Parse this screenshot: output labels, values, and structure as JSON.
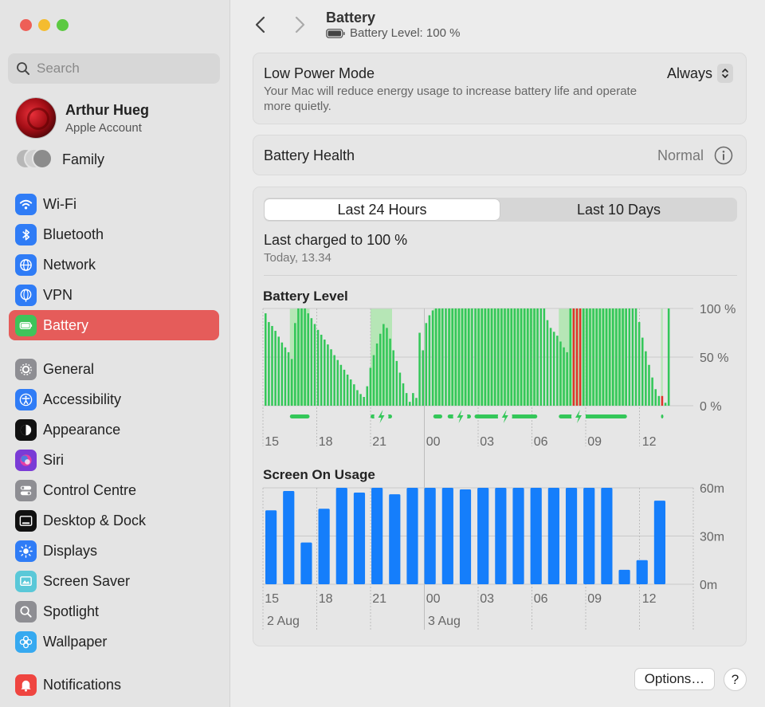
{
  "sidebar": {
    "search_placeholder": "Search",
    "account": {
      "name": "Arthur Hueg",
      "subtitle": "Apple Account"
    },
    "family_label": "Family",
    "items": [
      {
        "label": "Wi-Fi",
        "icon": "wifi-icon",
        "color": "#2f7cf6"
      },
      {
        "label": "Bluetooth",
        "icon": "bluetooth-icon",
        "color": "#2f7cf6"
      },
      {
        "label": "Network",
        "icon": "globe-icon",
        "color": "#2f7cf6"
      },
      {
        "label": "VPN",
        "icon": "vpn-globe-icon",
        "color": "#2f7cf6"
      },
      {
        "label": "Battery",
        "icon": "battery-icon",
        "color": "#3fc35a",
        "active": true
      },
      {
        "label": "General",
        "icon": "gear-icon",
        "color": "#8e8e93"
      },
      {
        "label": "Accessibility",
        "icon": "accessibility-icon",
        "color": "#2f7cf6"
      },
      {
        "label": "Appearance",
        "icon": "appearance-icon",
        "color": "#111111"
      },
      {
        "label": "Siri",
        "icon": "siri-icon",
        "color": "#7a3bd6"
      },
      {
        "label": "Control Centre",
        "icon": "control-centre-icon",
        "color": "#8e8e93"
      },
      {
        "label": "Desktop & Dock",
        "icon": "dock-icon",
        "color": "#111111"
      },
      {
        "label": "Displays",
        "icon": "sun-icon",
        "color": "#2f7cf6"
      },
      {
        "label": "Screen Saver",
        "icon": "screen-saver-icon",
        "color": "#5ac8d8"
      },
      {
        "label": "Spotlight",
        "icon": "magnifier-icon",
        "color": "#8e8e93"
      },
      {
        "label": "Wallpaper",
        "icon": "flower-icon",
        "color": "#36a9f0"
      },
      {
        "label": "Notifications",
        "icon": "bell-icon",
        "color": "#ef4540"
      }
    ]
  },
  "header": {
    "title": "Battery",
    "subtitle": "Battery Level: 100 %"
  },
  "low_power": {
    "title": "Low Power Mode",
    "description": "Your Mac will reduce energy usage to increase battery life and operate more quietly.",
    "value": "Always"
  },
  "health": {
    "label": "Battery Health",
    "value": "Normal"
  },
  "tabs": {
    "active": "Last 24 Hours",
    "inactive": "Last 10 Days"
  },
  "last_charged": {
    "title": "Last charged to 100 %",
    "time": "Today, 13.34"
  },
  "colors": {
    "battery_green": "#34c759",
    "charging_green": "#b6e6b6",
    "low_red": "#e0322b",
    "usage_blue": "#157efb",
    "active_red": "#e55c5a"
  },
  "chart_data": [
    {
      "type": "bar",
      "title": "Battery Level",
      "y_ticks": [
        "100 %",
        "50 %",
        "0 %"
      ],
      "ylim": [
        0,
        100
      ],
      "x_ticks": [
        "15",
        "18",
        "21",
        "00",
        "03",
        "06",
        "09",
        "12"
      ],
      "values": [
        95,
        86,
        82,
        77,
        71,
        65,
        60,
        55,
        48,
        85,
        100,
        100,
        100,
        95,
        90,
        84,
        78,
        73,
        68,
        63,
        58,
        52,
        47,
        42,
        37,
        32,
        27,
        22,
        16,
        12,
        9,
        20,
        39,
        52,
        64,
        74,
        84,
        80,
        69,
        57,
        46,
        34,
        23,
        13,
        4,
        13,
        8,
        75,
        57,
        85,
        93,
        98,
        100,
        100,
        100,
        100,
        100,
        100,
        100,
        100,
        100,
        100,
        100,
        100,
        100,
        100,
        100,
        100,
        100,
        100,
        100,
        100,
        100,
        100,
        100,
        100,
        100,
        100,
        100,
        100,
        100,
        100,
        100,
        100,
        100,
        100,
        88,
        80,
        76,
        72,
        66,
        60,
        55,
        100,
        100,
        100,
        100,
        100,
        100,
        100,
        100,
        100,
        100,
        100,
        100,
        100,
        100,
        100,
        100,
        100,
        100,
        100,
        100,
        100,
        86,
        70,
        56,
        42,
        29,
        17,
        10,
        10,
        3,
        100
      ],
      "low_indices": [
        94,
        95,
        96,
        121
      ],
      "charging_periods_hours": [
        [
          1.5,
          2.6
        ],
        [
          6.0,
          7.2
        ],
        [
          9.5,
          10.0
        ],
        [
          10.3,
          11.6
        ],
        [
          11.8,
          15.3
        ],
        [
          16.5,
          20.3
        ],
        [
          22.2,
          22.3
        ]
      ]
    },
    {
      "type": "bar",
      "title": "Screen On Usage",
      "y_ticks": [
        "60m",
        "30m",
        "0m"
      ],
      "ylim": [
        0,
        60
      ],
      "x_ticks": [
        "15",
        "18",
        "21",
        "00",
        "03",
        "06",
        "09",
        "12"
      ],
      "date_labels": [
        "2 Aug",
        "3 Aug"
      ],
      "values": [
        46,
        58,
        26,
        47,
        60,
        57,
        60,
        56,
        60,
        60,
        60,
        59,
        60,
        60,
        60,
        60,
        60,
        60,
        60,
        60,
        9,
        15,
        52
      ]
    }
  ],
  "footer": {
    "options_label": "Options…",
    "help_label": "?"
  }
}
